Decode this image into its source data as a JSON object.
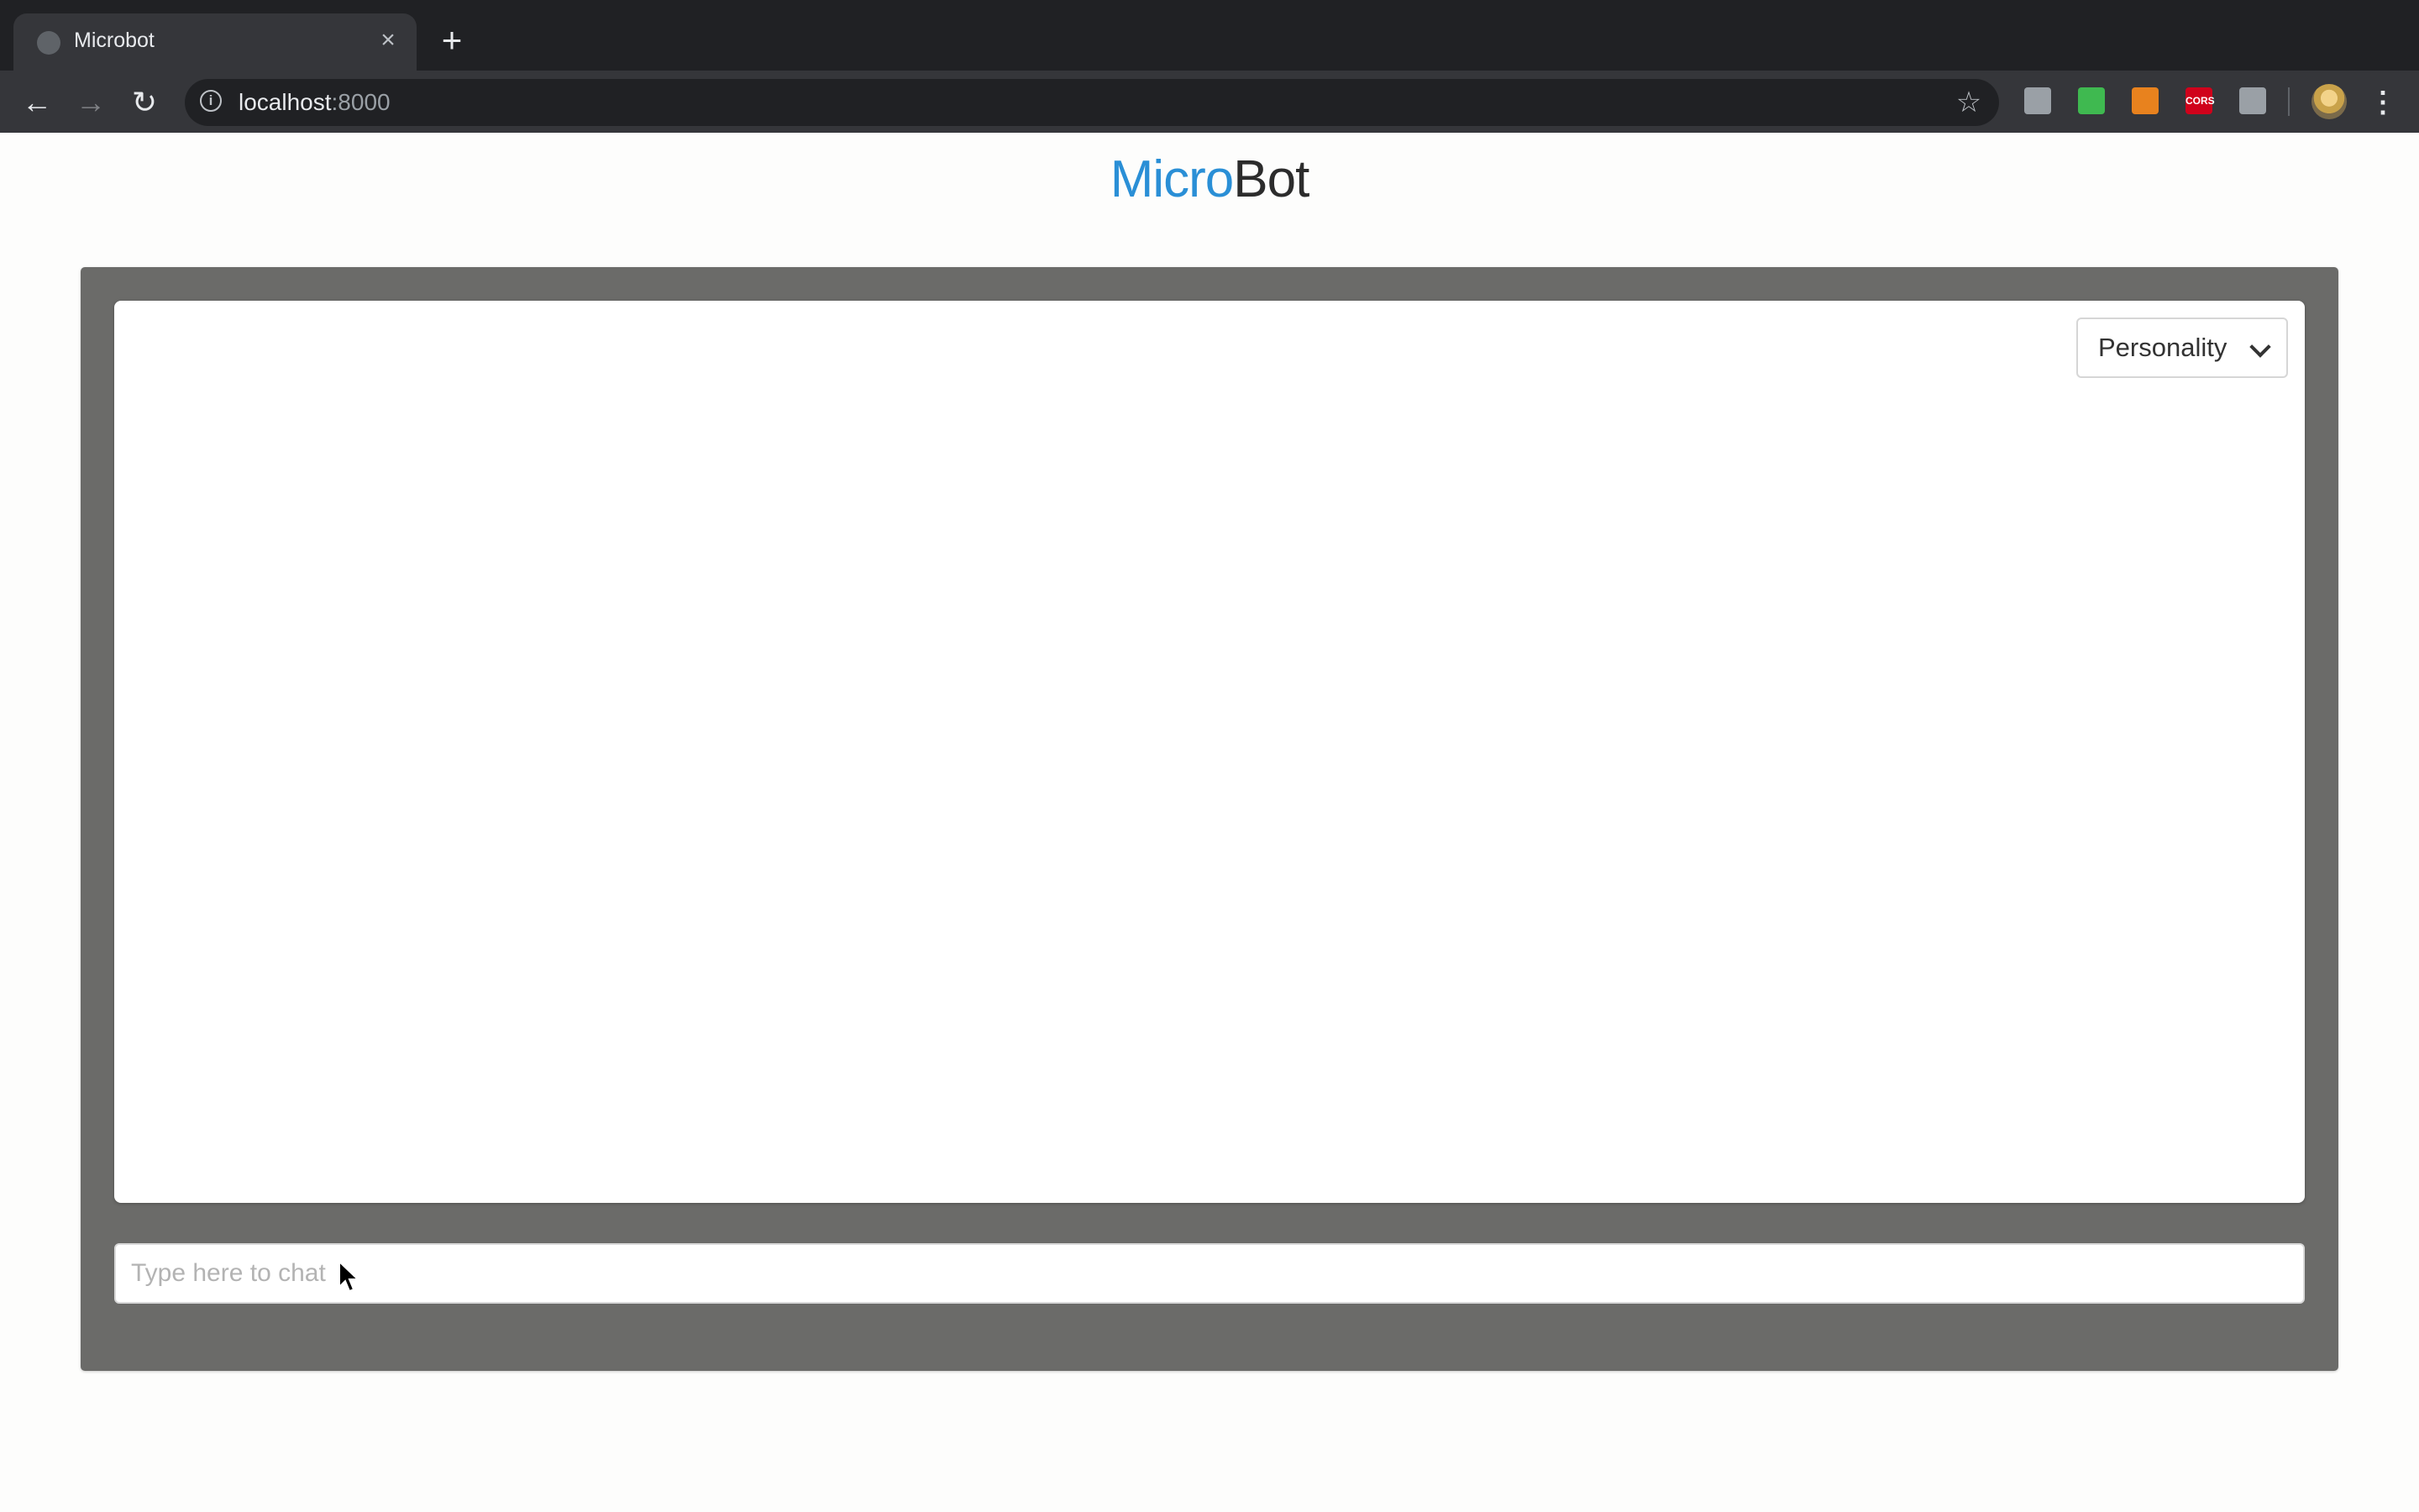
{
  "browser": {
    "tab_title": "Microbot",
    "url_host": "localhost",
    "url_port": ":8000",
    "extensions": [
      {
        "name": "turtle-extension-icon",
        "color": "#9aa0a6",
        "label": ""
      },
      {
        "name": "green-extension-icon",
        "color": "#3fb950",
        "label": ""
      },
      {
        "name": "fox-extension-icon",
        "color": "#e8821e",
        "label": ""
      },
      {
        "name": "cors-extension-icon",
        "color": "#d0021b",
        "label": "CORS"
      },
      {
        "name": "grey-extension-icon",
        "color": "#9aa0a6",
        "label": ""
      }
    ]
  },
  "page": {
    "brand_part1": "Micro",
    "brand_part2": "Bot",
    "brand_color": "#2a8fd6",
    "personality_label": "Personality",
    "chat_placeholder": "Type here to chat"
  }
}
